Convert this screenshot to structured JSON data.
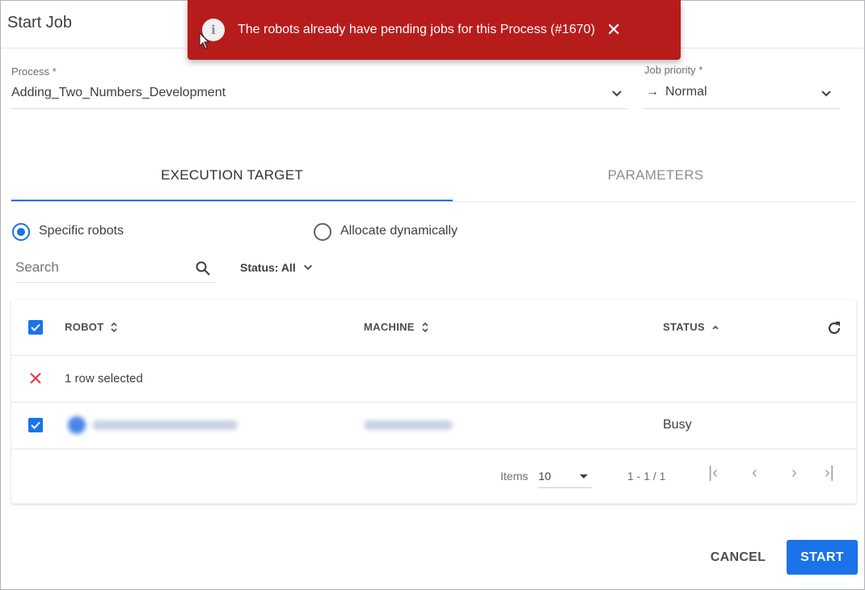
{
  "dialog": {
    "title": "Start Job"
  },
  "toast": {
    "message": "The robots already have pending jobs for this Process (#1670)",
    "close_glyph": "✕",
    "icon": "info-icon",
    "icon_glyph": "i",
    "color": "#b71c1c"
  },
  "form": {
    "process": {
      "label": "Process *",
      "value": "Adding_Two_Numbers_Development"
    },
    "priority": {
      "label": "Job priority *",
      "value": "Normal",
      "arrow_glyph": "→"
    }
  },
  "tabs": [
    {
      "label": "EXECUTION TARGET",
      "active": true
    },
    {
      "label": "PARAMETERS",
      "active": false
    }
  ],
  "target": {
    "options": [
      {
        "label": "Specific robots",
        "selected": true
      },
      {
        "label": "Allocate dynamically",
        "selected": false
      }
    ]
  },
  "filters": {
    "search_placeholder": "Search",
    "status_label": "Status: All"
  },
  "table": {
    "columns": [
      "ROBOT",
      "MACHINE",
      "STATUS"
    ],
    "selection_text": "1 row selected",
    "rows": [
      {
        "robot": "",
        "machine": "",
        "status": "Busy",
        "checked": true
      }
    ],
    "pager": {
      "items_label": "Items",
      "page_size": "10",
      "range": "1 - 1 / 1",
      "first_glyph": "|‹",
      "prev_glyph": "‹",
      "next_glyph": "›",
      "last_glyph": "›|"
    }
  },
  "footer": {
    "cancel": "CANCEL",
    "start": "START"
  },
  "colors": {
    "accent": "#1a73e8",
    "error": "#b71c1c",
    "clear": "#e53950"
  }
}
